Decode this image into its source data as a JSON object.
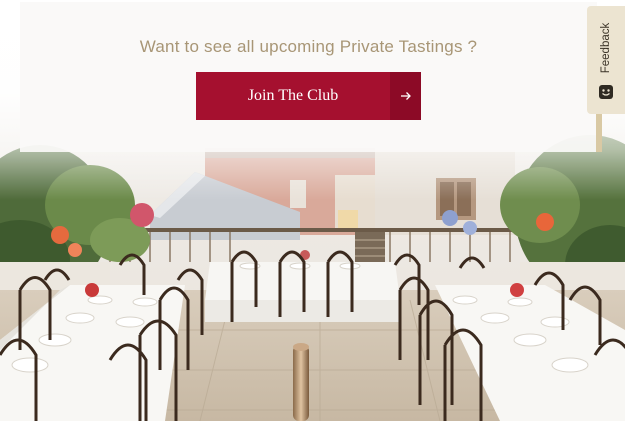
{
  "promo": {
    "heading": "Want to see all upcoming Private Tastings ?",
    "cta_label": "Join The Club",
    "cta_icon": "arrow-right-icon"
  },
  "feedback": {
    "label": "Feedback",
    "icon": "smiley-face-icon"
  },
  "colors": {
    "accent": "#a5102f",
    "accent_dark": "#8c0a26",
    "heading_text": "#a89676",
    "feedback_bg": "#ece4d1"
  },
  "background_image": {
    "subject": "outdoor terrace dining setup"
  }
}
